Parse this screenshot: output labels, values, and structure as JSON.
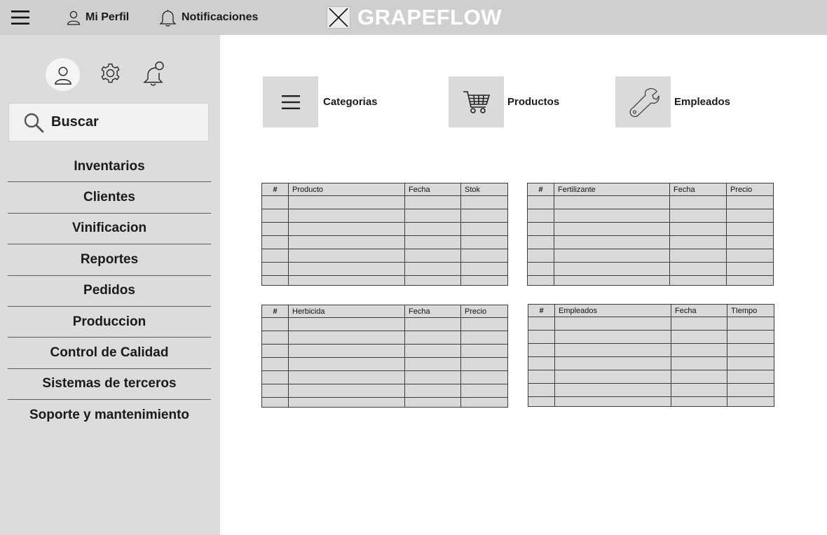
{
  "header": {
    "menu_icon": "hamburger-menu-icon",
    "profile_label": "Mi Perfil",
    "notifications_label": "Notificaciones",
    "brand_name": "GRAPEFLOW"
  },
  "sidebar": {
    "icons": [
      "user-icon",
      "gear-icon",
      "notification-bell-icon"
    ],
    "search_label": "Buscar",
    "items": [
      {
        "label": "Inventarios"
      },
      {
        "label": "Clientes"
      },
      {
        "label": "Vinificacion"
      },
      {
        "label": "Reportes"
      },
      {
        "label": "Pedidos"
      },
      {
        "label": "Produccion"
      },
      {
        "label": "Control de Calidad"
      },
      {
        "label": "Sistemas de terceros"
      },
      {
        "label": "Soporte y mantenimiento"
      }
    ]
  },
  "quick_actions": [
    {
      "label": "Categorias",
      "icon": "list-icon"
    },
    {
      "label": "Productos",
      "icon": "shopping-cart-icon"
    },
    {
      "label": "Empleados",
      "icon": "wrench-icon"
    }
  ],
  "tables": [
    {
      "headers": [
        "#",
        "Producto",
        "Fecha",
        "Stok"
      ]
    },
    {
      "headers": [
        "#",
        "Fertilizante",
        "Fecha",
        "Precio"
      ]
    },
    {
      "headers": [
        "#",
        "Herbicida",
        "Fecha",
        "Precio"
      ]
    },
    {
      "headers": [
        "#",
        "Empleados",
        "Fecha",
        "TIempo"
      ]
    }
  ]
}
